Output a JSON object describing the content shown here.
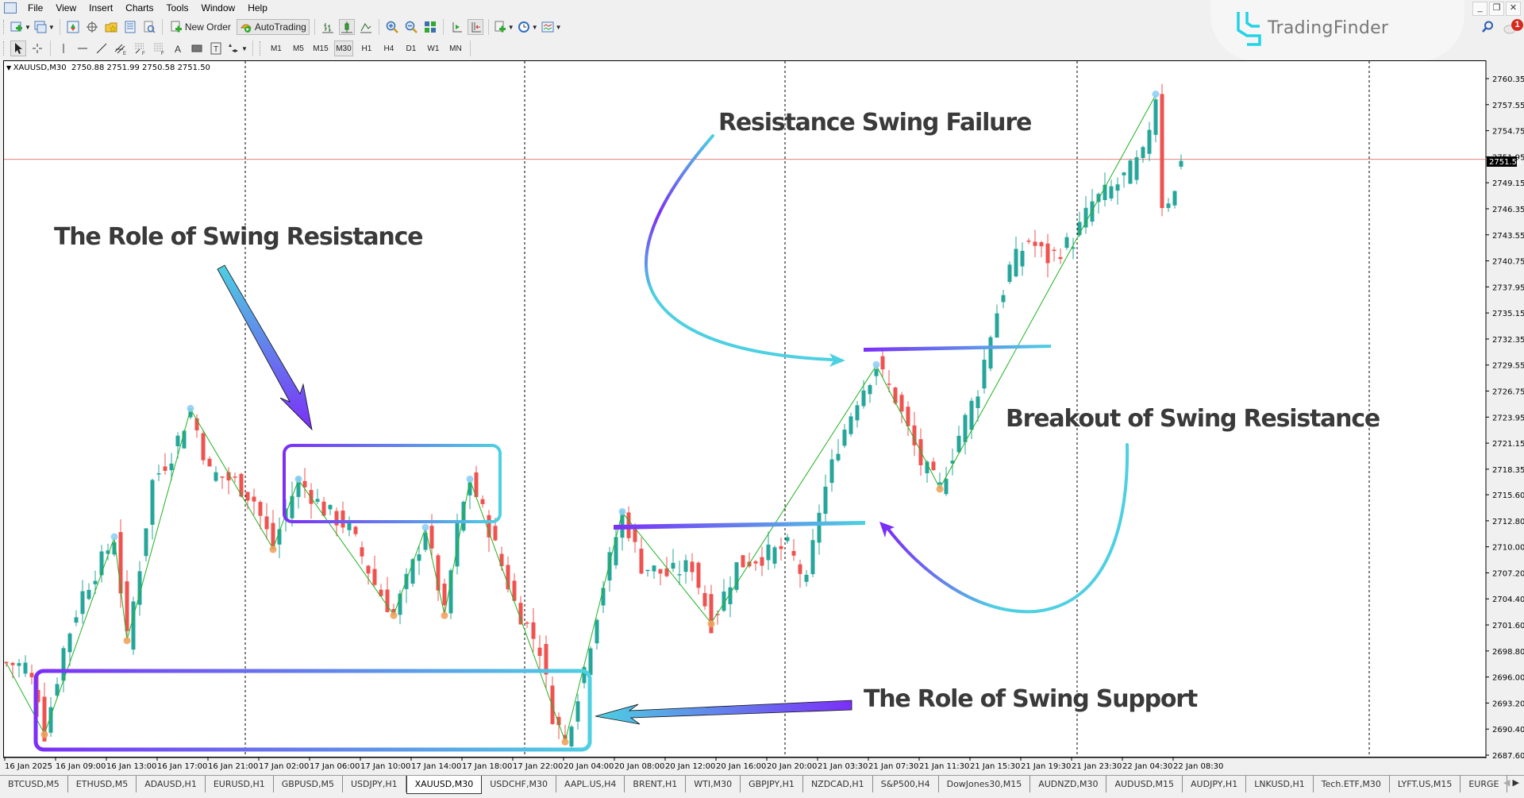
{
  "menu": [
    "File",
    "View",
    "Insert",
    "Charts",
    "Tools",
    "Window",
    "Help"
  ],
  "window_controls": {
    "minimize": "_",
    "restore": "❐",
    "close": "✕"
  },
  "toolbar": {
    "new_order_label": "New Order",
    "autotrading_label": "AutoTrading",
    "timeframes": [
      "M1",
      "M5",
      "M15",
      "M30",
      "H1",
      "H4",
      "D1",
      "W1",
      "MN"
    ],
    "active_timeframe": "M30"
  },
  "brand": {
    "name": "TradingFinder",
    "color": "#22d3e6"
  },
  "notifications": {
    "count": "1"
  },
  "chart": {
    "symbol_info": "XAUUSD,M30  2750.88 2751.99 2750.58 2751.50",
    "current_price_label": "2751.50",
    "colors": {
      "bull": "#26a69a",
      "bear": "#ef5350",
      "zigzag": "#1fb31f",
      "swing_high": "#8fd0f5",
      "swing_low": "#f0a35e",
      "price_line": "#e08080",
      "grad_start": "#7b2ff7",
      "grad_end": "#4dd0e1"
    }
  },
  "annotations": {
    "role_resistance": "The Role of Swing Resistance",
    "resistance_failure": "Resistance Swing Failure",
    "breakout": "Breakout of Swing Resistance",
    "role_support": "The Role of Swing Support"
  },
  "chart_data": {
    "type": "candlestick",
    "title": "XAUUSD,M30",
    "ylim": [
      2687.6,
      2762.0
    ],
    "y_ticks": [
      "2760.35",
      "2757.55",
      "2754.75",
      "2751.95",
      "2749.15",
      "2746.35",
      "2743.55",
      "2740.75",
      "2737.95",
      "2735.15",
      "2732.35",
      "2729.55",
      "2726.75",
      "2723.95",
      "2721.15",
      "2718.35",
      "2715.60",
      "2712.80",
      "2710.00",
      "2707.20",
      "2704.40",
      "2701.60",
      "2698.80",
      "2696.00",
      "2693.20",
      "2690.40",
      "2687.60"
    ],
    "x_ticks": [
      "16 Jan 2025",
      "16 Jan 09:00",
      "16 Jan 13:00",
      "16 Jan 17:00",
      "16 Jan 21:00",
      "17 Jan 02:00",
      "17 Jan 06:00",
      "17 Jan 10:00",
      "17 Jan 14:00",
      "17 Jan 18:00",
      "17 Jan 22:00",
      "20 Jan 04:00",
      "20 Jan 08:00",
      "20 Jan 12:00",
      "20 Jan 16:00",
      "20 Jan 20:00",
      "21 Jan 03:30",
      "21 Jan 07:30",
      "21 Jan 11:30",
      "21 Jan 15:30",
      "21 Jan 19:30",
      "21 Jan 23:30",
      "22 Jan 04:30",
      "22 Jan 08:30"
    ],
    "last_price": 2751.5,
    "swing_highs": [
      2711.0,
      2724.8,
      2717.2,
      2712.0,
      2717.2,
      2713.7,
      2729.5,
      2758.6
    ],
    "swing_lows": [
      2689.9,
      2700.0,
      2709.8,
      2702.7,
      2702.7,
      2689.1,
      2701.8,
      2716.3
    ],
    "zigzag": [
      [
        0,
        2697.5
      ],
      [
        6,
        2689.9
      ],
      [
        17,
        2711.0
      ],
      [
        19,
        2700.0
      ],
      [
        29,
        2724.8
      ],
      [
        42,
        2709.8
      ],
      [
        46,
        2717.2
      ],
      [
        61,
        2702.7
      ],
      [
        66,
        2712.0
      ],
      [
        69,
        2702.7
      ],
      [
        73,
        2717.2
      ],
      [
        88,
        2689.1
      ],
      [
        97,
        2713.7
      ],
      [
        111,
        2701.8
      ],
      [
        137,
        2729.5
      ],
      [
        147,
        2716.3
      ],
      [
        181,
        2758.6
      ]
    ],
    "anchors": [
      [
        0,
        2697.5
      ],
      [
        3,
        2697.2
      ],
      [
        5,
        2694.0
      ],
      [
        6,
        2689.9
      ],
      [
        9,
        2699
      ],
      [
        12,
        2705
      ],
      [
        15,
        2708.5
      ],
      [
        17,
        2711.0
      ],
      [
        19,
        2700.0
      ],
      [
        21,
        2708
      ],
      [
        23,
        2717
      ],
      [
        26,
        2720
      ],
      [
        29,
        2724.8
      ],
      [
        32,
        2718
      ],
      [
        36,
        2717
      ],
      [
        39,
        2715
      ],
      [
        42,
        2709.8
      ],
      [
        44,
        2714
      ],
      [
        46,
        2717.2
      ],
      [
        50,
        2714
      ],
      [
        54,
        2712
      ],
      [
        58,
        2706
      ],
      [
        61,
        2702.7
      ],
      [
        64,
        2708
      ],
      [
        66,
        2712.0
      ],
      [
        69,
        2702.7
      ],
      [
        71,
        2712
      ],
      [
        73,
        2717.2
      ],
      [
        76,
        2712
      ],
      [
        80,
        2704
      ],
      [
        84,
        2699
      ],
      [
        86,
        2692
      ],
      [
        88,
        2689.1
      ],
      [
        91,
        2697
      ],
      [
        94,
        2706
      ],
      [
        97,
        2713.7
      ],
      [
        100,
        2708
      ],
      [
        104,
        2707
      ],
      [
        108,
        2708
      ],
      [
        111,
        2701.8
      ],
      [
        115,
        2708
      ],
      [
        119,
        2709
      ],
      [
        123,
        2710
      ],
      [
        126,
        2706
      ],
      [
        128,
        2714
      ],
      [
        131,
        2721
      ],
      [
        134,
        2726
      ],
      [
        137,
        2729.5
      ],
      [
        140,
        2726
      ],
      [
        144,
        2719
      ],
      [
        147,
        2716.3
      ],
      [
        150,
        2722
      ],
      [
        153,
        2727
      ],
      [
        155,
        2733
      ],
      [
        158,
        2740
      ],
      [
        161,
        2743
      ],
      [
        164,
        2741
      ],
      [
        168,
        2743
      ],
      [
        171,
        2747
      ],
      [
        175,
        2749
      ],
      [
        179,
        2752
      ],
      [
        181,
        2758.6
      ],
      [
        182,
        2747
      ],
      [
        184,
        2748
      ],
      [
        185,
        2751.5
      ]
    ]
  }
}
